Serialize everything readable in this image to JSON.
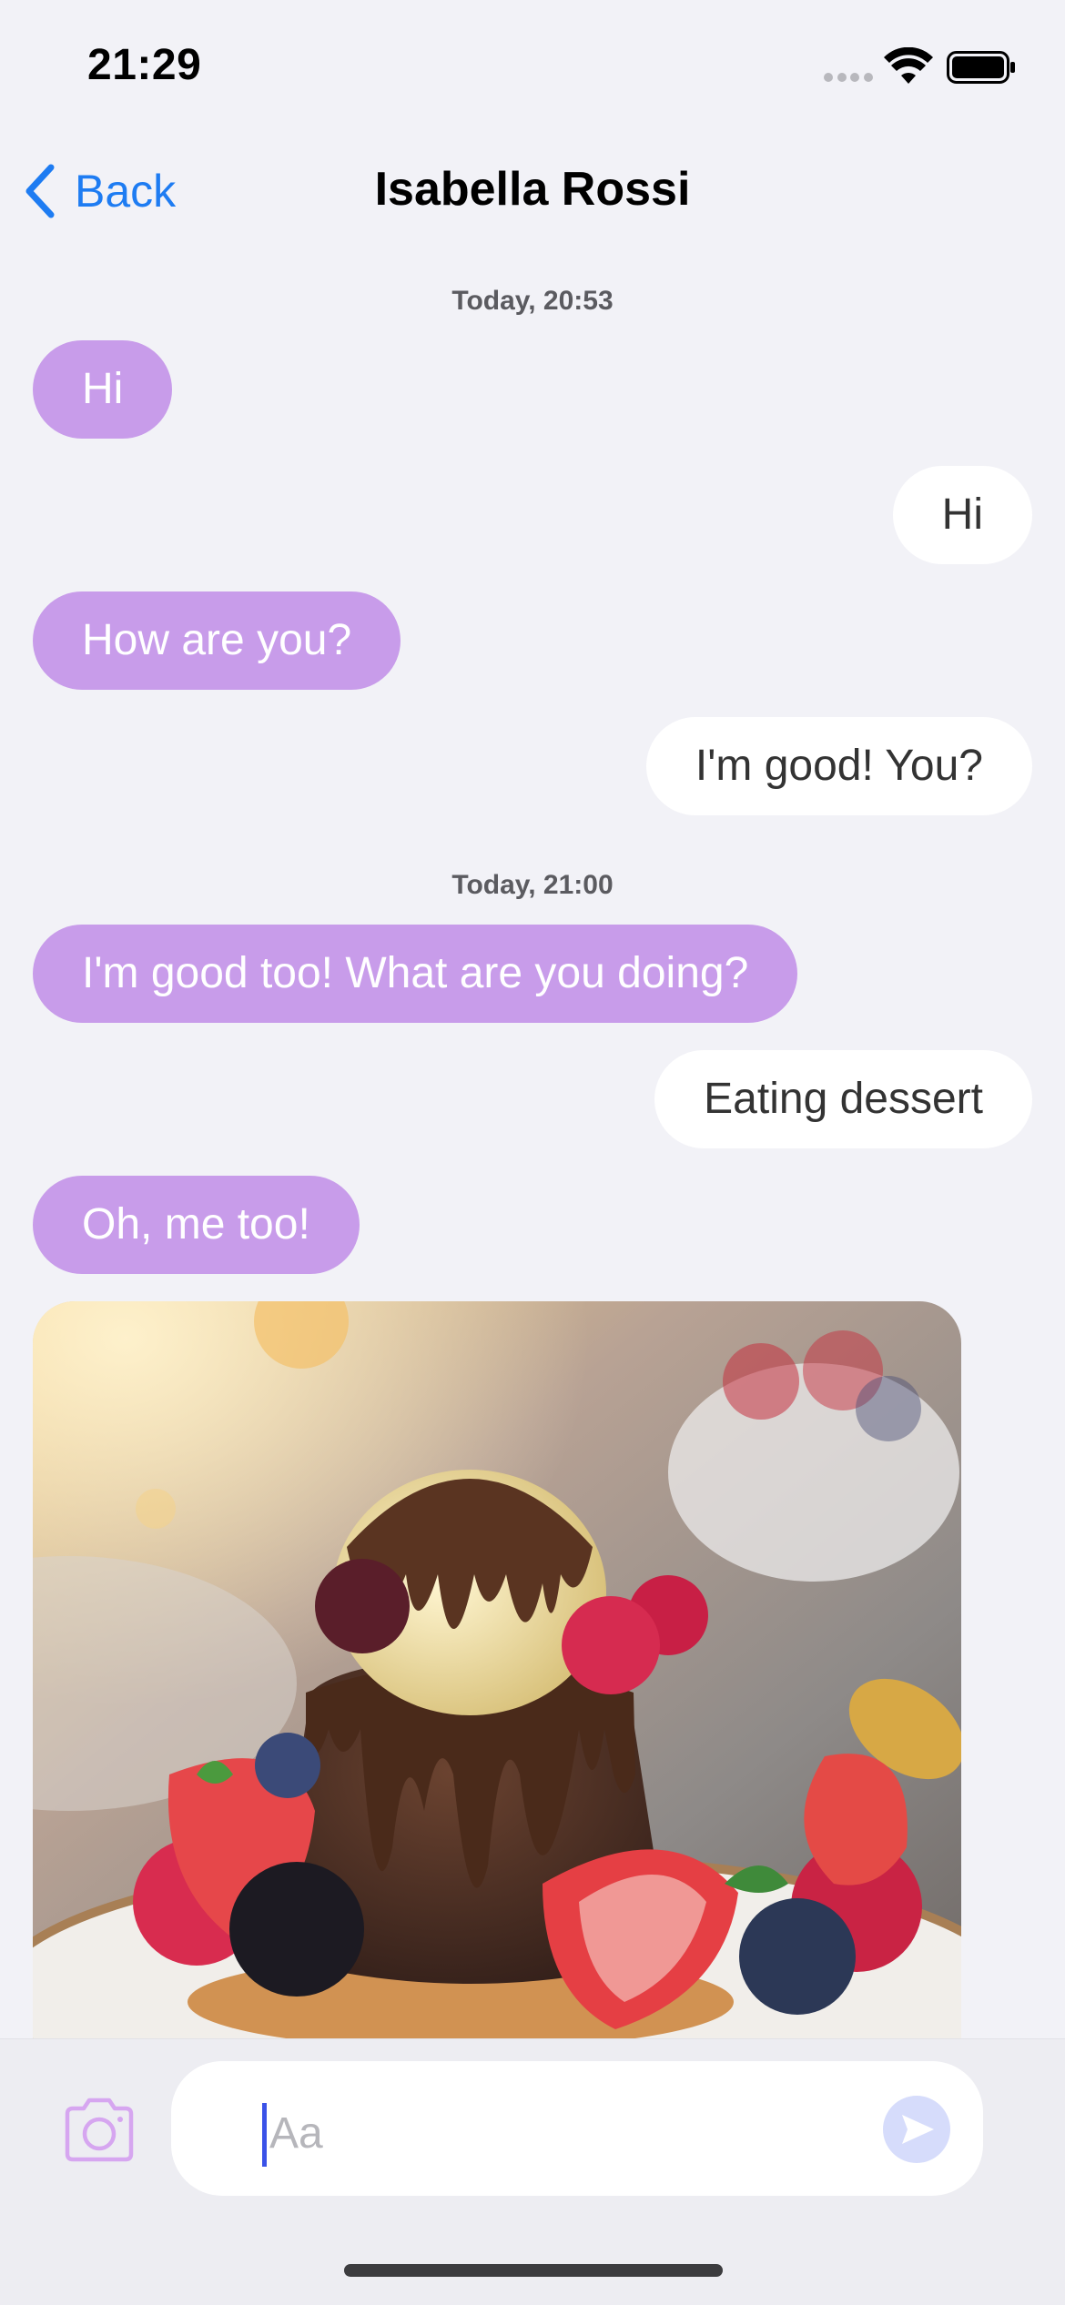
{
  "status_bar": {
    "time": "21:29"
  },
  "nav": {
    "back_label": "Back",
    "title": "Isabella Rossi"
  },
  "messages": {
    "ts1": "Today, 20:53",
    "m1": "Hi",
    "m2": "Hi",
    "m3": "How are you?",
    "m4": "I'm good! You?",
    "ts2": "Today, 21:00",
    "m5": "I'm good too! What are you doing?",
    "m6": "Eating dessert",
    "m7": "Oh, me too!"
  },
  "composer": {
    "placeholder": "Aa"
  },
  "colors": {
    "accent_blue": "#1e7cf2",
    "incoming_bubble": "#c89cea",
    "outgoing_bubble": "#ffffff",
    "background": "#f2f2f7"
  },
  "icons": [
    "chevron-left-icon",
    "camera-icon",
    "send-icon",
    "wifi-icon",
    "battery-icon"
  ]
}
